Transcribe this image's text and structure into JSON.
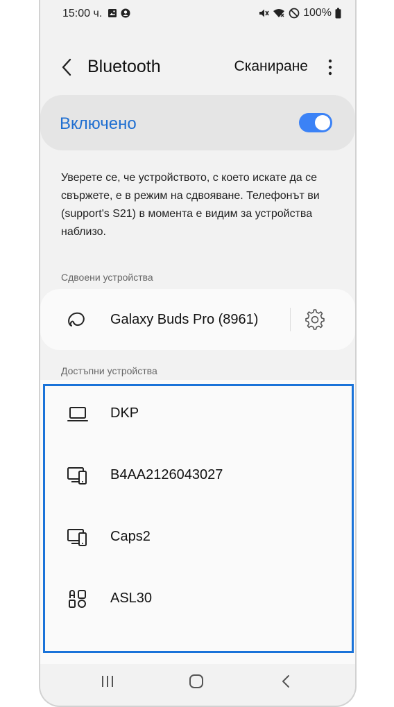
{
  "status_bar": {
    "time": "15:00 ч.",
    "battery": "100%",
    "icons": [
      "image-icon",
      "account-circle-icon",
      "mute-icon",
      "wifi-icon",
      "no-disturb-icon",
      "battery-icon"
    ]
  },
  "header": {
    "title": "Bluetooth",
    "scan_label": "Сканиране"
  },
  "toggle": {
    "label": "Включено",
    "state": true,
    "accent": "#3b82f6",
    "label_color": "#1f6fd1"
  },
  "description": "Уверете се, че устройството, с което искате да се свържете, е в режим на сдвояване. Телефонът ви (support's S21) в момента е видим за устройства наблизо.",
  "paired": {
    "header": "Сдвоени устройства",
    "devices": [
      {
        "name": "Galaxy Buds Pro (8961)",
        "icon": "earbuds-icon"
      }
    ]
  },
  "available": {
    "header": "Достъпни устройства",
    "highlight_color": "#1a73d9",
    "devices": [
      {
        "name": "DKP",
        "icon": "laptop-icon"
      },
      {
        "name": "B4AA2126043027",
        "icon": "monitor-phone-icon"
      },
      {
        "name": "Caps2",
        "icon": "monitor-phone-icon"
      },
      {
        "name": "ASL30",
        "icon": "devices-grid-icon"
      }
    ]
  },
  "nav_bar": {
    "buttons": [
      "recents-icon",
      "home-icon",
      "back-icon"
    ]
  }
}
